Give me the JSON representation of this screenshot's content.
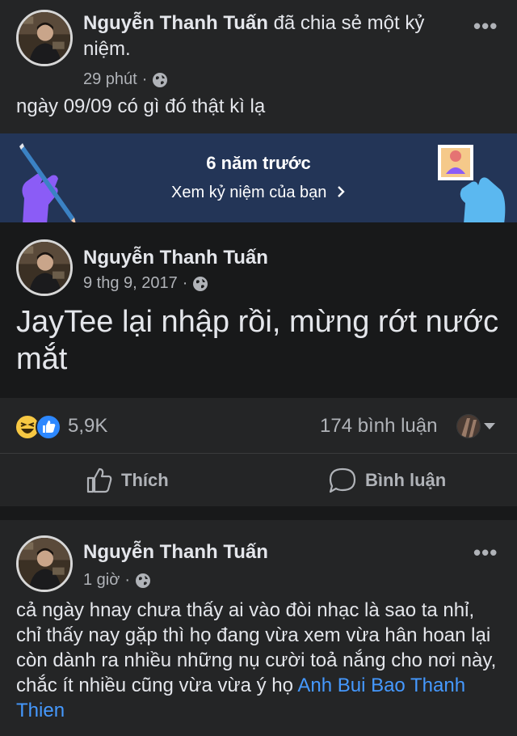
{
  "post1": {
    "author": "Nguyễn Thanh Tuấn",
    "shared_text": "đã chia sẻ một kỷ niệm.",
    "time": "29 phút",
    "more_label": "•••",
    "caption": "ngày 09/09 có gì đó thật kì lạ",
    "memory": {
      "title": "6 năm trước",
      "link_label": "Xem kỷ niệm của bạn",
      "colors": {
        "background": "#233557",
        "left_hand": "#8b5cf6",
        "right_hand": "#5bb8f0"
      }
    },
    "original": {
      "author": "Nguyễn Thanh Tuấn",
      "date": "9 thg 9, 2017",
      "content": "JayTee lại nhập rồi, mừng rớt nước mắt"
    },
    "stats": {
      "reactions_count": "5,9K",
      "comments_label": "174 bình luận"
    },
    "actions": {
      "like_label": "Thích",
      "comment_label": "Bình luận"
    }
  },
  "post2": {
    "author": "Nguyễn Thanh Tuấn",
    "time": "1 giờ",
    "more_label": "•••",
    "content": "cả ngày hnay chưa thấy ai vào đòi nhạc là sao ta nhỉ, chỉ thấy nay gặp thì họ đang vừa xem vừa hân hoan lại còn dành ra nhiều những nụ cười toả nắng cho nơi này, chắc ít nhiều cũng vừa vừa ý họ",
    "mention": "Anh Bui Bao Thanh Thien"
  },
  "icons": [
    "globe-icon",
    "more-icon",
    "chevron-right-icon",
    "haha-reaction-icon",
    "like-reaction-icon",
    "thumbs-up-icon",
    "comment-bubble-icon",
    "caret-down-icon"
  ],
  "colors": {
    "background": "#18191a",
    "card": "#242526",
    "text": "#e4e6eb",
    "secondary": "#b0b3b8",
    "link": "#4599ff"
  }
}
